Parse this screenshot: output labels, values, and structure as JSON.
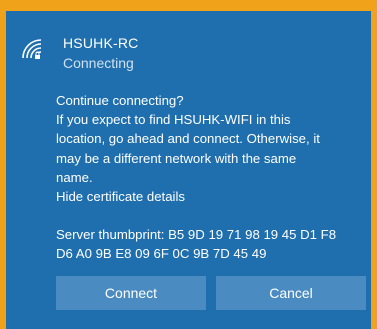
{
  "network": {
    "name": "HSUHK-RC",
    "status": "Connecting",
    "icon": "wifi-secured-icon"
  },
  "message": {
    "lines": [
      "Continue connecting?",
      "If you expect to find HSUHK-WIFI in this",
      "location, go ahead and connect. Otherwise, it",
      "may be a different network with the same",
      "name."
    ],
    "hide_details_label": "Hide certificate details",
    "thumbprint_lines": [
      "Server thumbprint: B5 9D 19 71 98 19 45 D1 F8",
      "D6 A0 9B E8 09 6F 0C 9B 7D 45 49"
    ]
  },
  "buttons": {
    "connect_label": "Connect",
    "cancel_label": "Cancel"
  },
  "colors": {
    "panel_background": "#1f6fae",
    "button_background": "#4a8cc2",
    "border_accent": "#f0a21a"
  }
}
